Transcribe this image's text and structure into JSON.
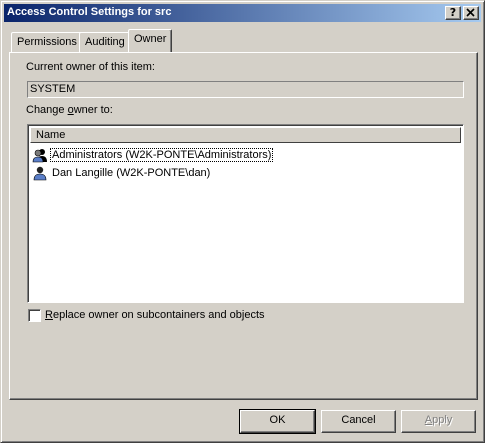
{
  "window": {
    "title": "Access Control Settings for src",
    "help_button": "?",
    "close_button": "x"
  },
  "tabs": [
    {
      "label": "Permissions",
      "active": false
    },
    {
      "label": "Auditing",
      "active": false
    },
    {
      "label": "Owner",
      "active": true
    }
  ],
  "owner_tab": {
    "current_owner_label": "Current owner of this item:",
    "current_owner_value": "SYSTEM",
    "change_owner_label_pre": "Change ",
    "change_owner_label_mnemonic": "o",
    "change_owner_label_post": "wner to:",
    "list_column_header": "Name",
    "list_items": [
      {
        "label": "Administrators (W2K-PONTE\\Administrators)",
        "icon": "group-icon",
        "focused": true
      },
      {
        "label": "Dan Langille (W2K-PONTE\\dan)",
        "icon": "user-icon",
        "focused": false
      }
    ],
    "replace_checkbox": {
      "checked": false,
      "label_mnemonic": "R",
      "label_rest": "eplace owner on subcontainers and objects"
    }
  },
  "buttons": {
    "ok": "OK",
    "cancel": "Cancel",
    "apply_mnemonic": "A",
    "apply_rest": "pply"
  },
  "colors": {
    "title_gradient_start": "#0a246a",
    "title_gradient_end": "#a6caf0",
    "face": "#d4d0c8"
  }
}
